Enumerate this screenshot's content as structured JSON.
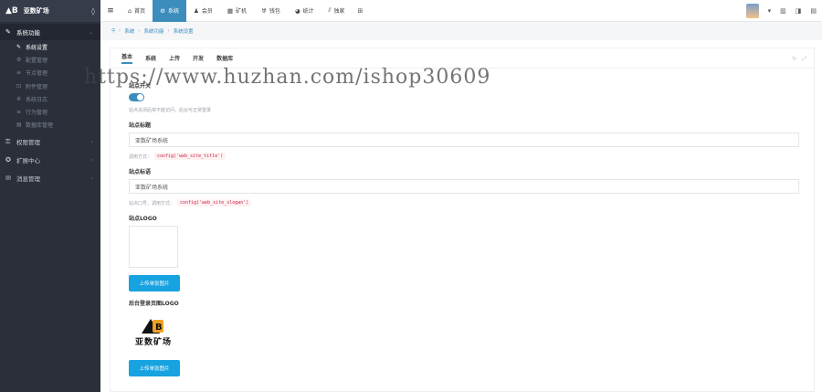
{
  "brand": {
    "name": "亚数矿场"
  },
  "sidebar": {
    "groups": [
      {
        "label": "系统功能",
        "icon": "wrench-icon",
        "expanded": true,
        "items": [
          {
            "label": "系统设置",
            "current": true
          },
          {
            "label": "配置管理"
          },
          {
            "label": "节点管理"
          },
          {
            "label": "附件管理"
          },
          {
            "label": "系统日志"
          },
          {
            "label": "行为管理"
          },
          {
            "label": "数据库管理"
          }
        ]
      },
      {
        "label": "权限管理"
      },
      {
        "label": "扩展中心"
      },
      {
        "label": "消息管理"
      }
    ]
  },
  "topnav": {
    "items": [
      {
        "label": "首页",
        "icon": "home-icon"
      },
      {
        "label": "系统",
        "icon": "gear-icon",
        "active": true
      },
      {
        "label": "会员",
        "icon": "user-icon"
      },
      {
        "label": "矿机",
        "icon": "server-icon"
      },
      {
        "label": "钱包",
        "icon": "wallet-icon"
      },
      {
        "label": "统计",
        "icon": "pie-icon"
      },
      {
        "label": "独家",
        "icon": "chart-icon"
      }
    ]
  },
  "breadcrumb": [
    "系统",
    "系统功能",
    "系统设置"
  ],
  "tabs": [
    "基本",
    "系统",
    "上传",
    "开发",
    "数据库"
  ],
  "form": {
    "switch_label": "站点开关",
    "switch_help": "站点关闭后将不能访问，后台可正常登录",
    "title_label": "站点标题",
    "title_value": "亚数矿场系统",
    "title_help_prefix": "调用方式：",
    "title_help_code": "config('web_site_title')",
    "slogan_label": "站点标语",
    "slogan_value": "亚数矿场系统",
    "slogan_help_prefix": "站点口号，调用方式：",
    "slogan_help_code": "config('web_site_slogan')",
    "logo_label": "站点LOGO",
    "upload_label": "上传单张图片",
    "login_logo_label": "后台登录页图LOGO",
    "login_logo_text": "亚数矿场",
    "upload_label_2": "上传单张图片"
  },
  "watermark": "https://www.huzhan.com/ishop30609",
  "colors": {
    "accent": "#3c8dbc",
    "upload": "#17a2e0",
    "sidebar": "#2a2f3a"
  }
}
